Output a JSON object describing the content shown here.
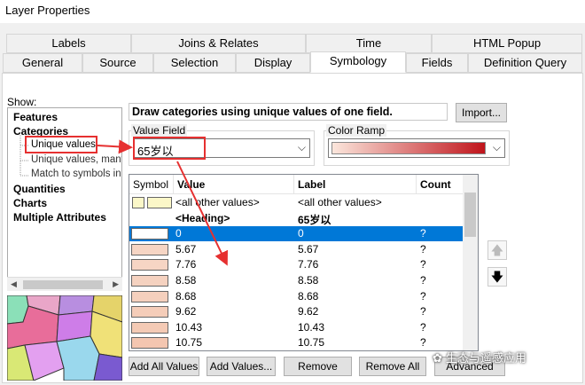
{
  "window": {
    "title": "Layer Properties"
  },
  "tabs_row1": [
    "Labels",
    "Joins & Relates",
    "Time",
    "HTML Popup"
  ],
  "tabs_row2": [
    "General",
    "Source",
    "Selection",
    "Display",
    "Symbology",
    "Fields",
    "Definition Query"
  ],
  "active_tab": "Symbology",
  "show": {
    "label": "Show:",
    "items": [
      "Features",
      "Categories",
      "Unique values",
      "Unique values, many",
      "Match to symbols in a",
      "Quantities",
      "Charts",
      "Multiple Attributes"
    ]
  },
  "description": "Draw categories using unique values of one field.",
  "import_button": "Import...",
  "value_field": {
    "label": "Value Field",
    "value": "65岁以"
  },
  "color_ramp": {
    "label": "Color Ramp",
    "start": "#fbe6dc",
    "end": "#c0141b"
  },
  "table": {
    "headers": [
      "Symbol",
      "Value",
      "Label",
      "Count"
    ],
    "rows": [
      {
        "value": "<all other values>",
        "label": "<all other values>",
        "count": "",
        "fill": "#fbf7c8"
      },
      {
        "value": "<Heading>",
        "label": "65岁以",
        "count": "",
        "fill": ""
      },
      {
        "value": "0",
        "label": "0",
        "count": "?",
        "fill": "#ffffff"
      },
      {
        "value": "5.67",
        "label": "5.67",
        "count": "?",
        "fill": "#f6d5c4"
      },
      {
        "value": "7.76",
        "label": "7.76",
        "count": "?",
        "fill": "#f6d5c4"
      },
      {
        "value": "8.58",
        "label": "8.58",
        "count": "?",
        "fill": "#f5d2c0"
      },
      {
        "value": "8.68",
        "label": "8.68",
        "count": "?",
        "fill": "#f5d0bd"
      },
      {
        "value": "9.62",
        "label": "9.62",
        "count": "?",
        "fill": "#f5cdb9"
      },
      {
        "value": "10.43",
        "label": "10.43",
        "count": "?",
        "fill": "#f4cab5"
      },
      {
        "value": "10.75",
        "label": "10.75",
        "count": "?",
        "fill": "#f4c6b0"
      }
    ]
  },
  "buttons": {
    "add_all": "Add All Values",
    "add_values": "Add Values...",
    "remove": "Remove",
    "remove_all": "Remove All",
    "advanced": "Advanced"
  },
  "watermark": "生态与遥感应用",
  "colors": {
    "selection": "#0078d7",
    "highlight": "#e63030"
  }
}
